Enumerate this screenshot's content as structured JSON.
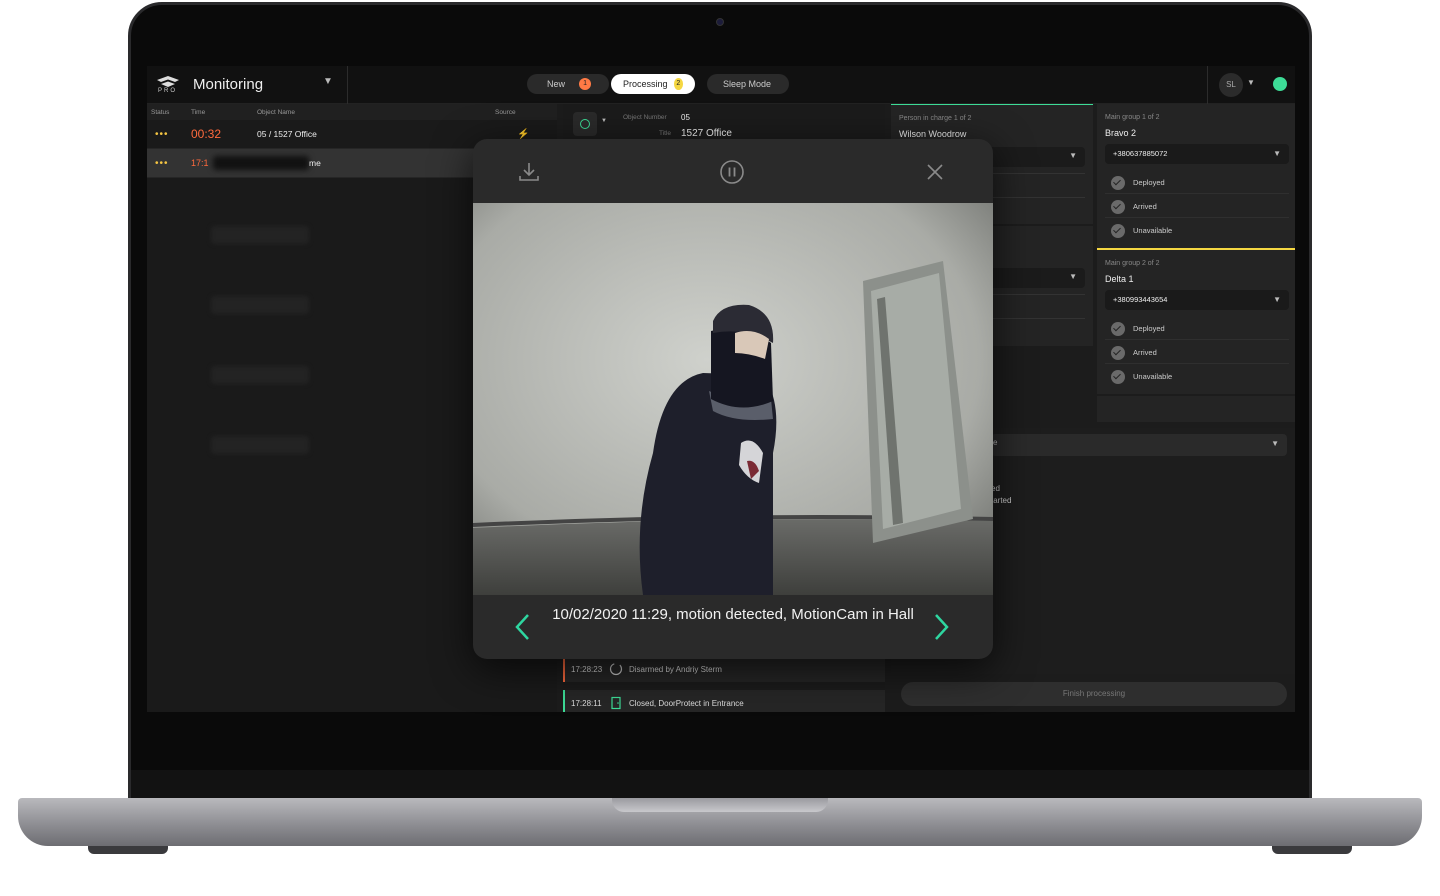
{
  "topbar": {
    "logo_sub": "PRO",
    "title": "Monitoring",
    "tabs": [
      {
        "label": "New",
        "badge": "1",
        "badge_color": "#ff7a45"
      },
      {
        "label": "Processing",
        "badge": "2",
        "badge_color": "#f5d742"
      },
      {
        "label": "Sleep Mode"
      }
    ],
    "user_initials": "SL",
    "status_color": "#3ddc97"
  },
  "list": {
    "columns": [
      "Status",
      "Time",
      "Object Name",
      "Source"
    ],
    "rows": [
      {
        "dots": "•••",
        "time": "00:32",
        "object": "05 / 1527 Office"
      },
      {
        "dots": "•••",
        "time": "17:1",
        "object": "me"
      }
    ]
  },
  "object": {
    "number_label": "Object Number",
    "number": "05",
    "title_label": "Title",
    "title": "1527 Office"
  },
  "events": [
    {
      "time": "17:28:23",
      "text": "Disarmed by Andriy Sterm",
      "color": "#ff6a3d"
    },
    {
      "time": "17:28:11",
      "text": "Closed, DoorProtect in Entrance",
      "color": "#3ddc97"
    }
  ],
  "person_in_charge": {
    "label": "Person in charge 1 of 2",
    "name": "Wilson Woodrow"
  },
  "groups": [
    {
      "label": "Main group 1 of 2",
      "name": "Bravo 2",
      "phone": "+380637885072",
      "statuses": [
        "Deployed",
        "Arrived",
        "Unavailable"
      ]
    },
    {
      "label": "Main group 2 of 2",
      "name": "Delta 1",
      "phone": "+380993443654",
      "statuses": [
        "Deployed",
        "Arrived",
        "Unavailable"
      ]
    }
  ],
  "partial_texts": [
    "e",
    "ed",
    "tarted"
  ],
  "finish_label": "Finish processing",
  "modal": {
    "caption": "10/02/2020 11:29, motion detected, MotionCam in Hall",
    "accent_color": "#2ed6a0"
  }
}
